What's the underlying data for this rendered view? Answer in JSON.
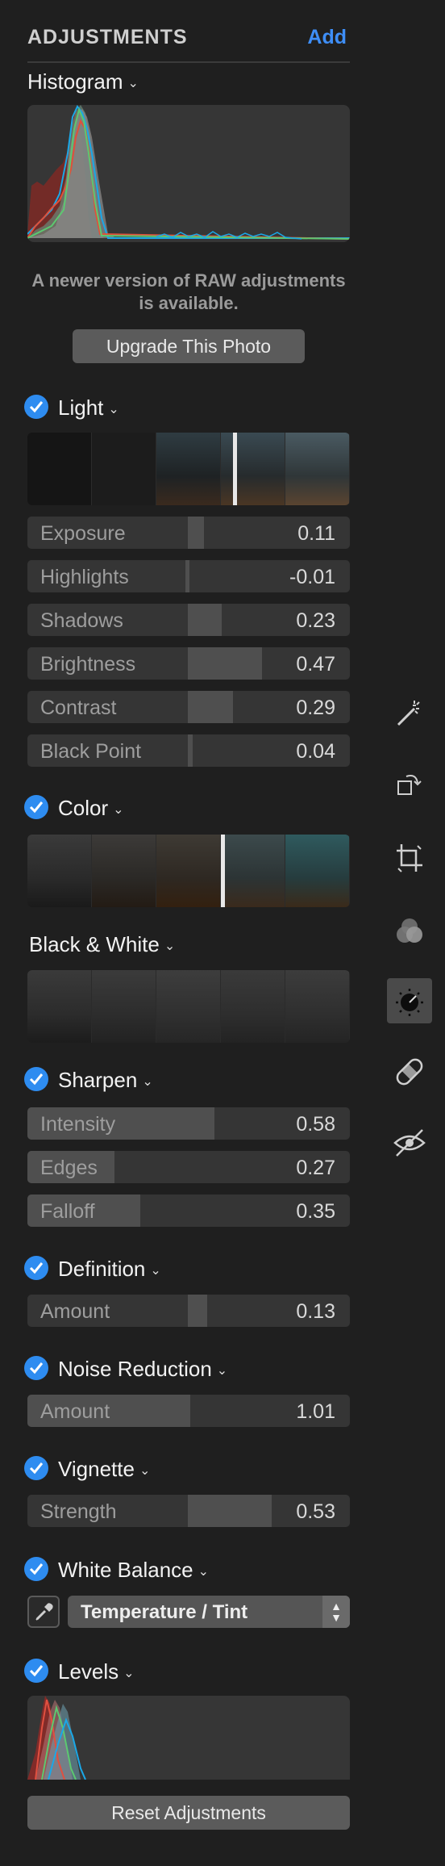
{
  "header": {
    "title": "ADJUSTMENTS",
    "add_label": "Add"
  },
  "histogram": {
    "title": "Histogram",
    "message": "A newer version of RAW adjustments is available.",
    "upgrade_label": "Upgrade This Photo"
  },
  "light": {
    "title": "Light",
    "sliders": [
      {
        "label": "Exposure",
        "value": "0.11"
      },
      {
        "label": "Highlights",
        "value": "-0.01"
      },
      {
        "label": "Shadows",
        "value": "0.23"
      },
      {
        "label": "Brightness",
        "value": "0.47"
      },
      {
        "label": "Contrast",
        "value": "0.29"
      },
      {
        "label": "Black Point",
        "value": "0.04"
      }
    ]
  },
  "color": {
    "title": "Color"
  },
  "black_white": {
    "title": "Black & White"
  },
  "sharpen": {
    "title": "Sharpen",
    "sliders": [
      {
        "label": "Intensity",
        "value": "0.58"
      },
      {
        "label": "Edges",
        "value": "0.27"
      },
      {
        "label": "Falloff",
        "value": "0.35"
      }
    ]
  },
  "definition": {
    "title": "Definition",
    "sliders": [
      {
        "label": "Amount",
        "value": "0.13"
      }
    ]
  },
  "noise_reduction": {
    "title": "Noise Reduction",
    "sliders": [
      {
        "label": "Amount",
        "value": "1.01"
      }
    ]
  },
  "vignette": {
    "title": "Vignette",
    "sliders": [
      {
        "label": "Strength",
        "value": "0.53"
      }
    ]
  },
  "white_balance": {
    "title": "White Balance",
    "mode": "Temperature / Tint"
  },
  "levels": {
    "title": "Levels"
  },
  "footer": {
    "reset_label": "Reset Adjustments"
  },
  "toolbar": {
    "icons": [
      "magic-wand-icon",
      "rotate-icon",
      "crop-icon",
      "filters-icon",
      "adjust-icon",
      "retouch-icon",
      "red-eye-icon"
    ],
    "active": "adjust-icon"
  },
  "colors": {
    "accent": "#3e8ef7",
    "check": "#2e8cf0",
    "background": "#1f1f1f"
  }
}
